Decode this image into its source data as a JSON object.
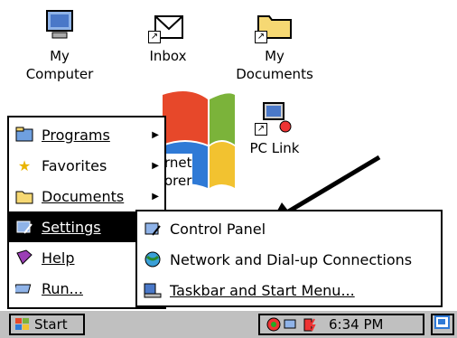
{
  "desktop": {
    "icons": [
      {
        "label": "My\nComputer"
      },
      {
        "label": "Inbox"
      },
      {
        "label": "My\nDocuments"
      },
      {
        "label": "PC Link"
      }
    ],
    "ie_partial_lines": [
      "rnet",
      "orer"
    ]
  },
  "start_menu": {
    "items": [
      {
        "label": "Programs",
        "submenu": true
      },
      {
        "label": "Favorites",
        "submenu": true
      },
      {
        "label": "Documents",
        "submenu": true
      },
      {
        "label": "Settings",
        "submenu": true,
        "selected": true
      },
      {
        "label": "Help",
        "submenu": false
      },
      {
        "label": "Run...",
        "submenu": false
      }
    ]
  },
  "settings_submenu": {
    "items": [
      {
        "label": "Control Panel"
      },
      {
        "label": "Network and Dial-up Connections"
      },
      {
        "label": "Taskbar and Start Menu..."
      }
    ]
  },
  "taskbar": {
    "start_label": "Start",
    "clock": "6:34 PM"
  },
  "colors": {
    "taskbar_bg": "#c0c0c0",
    "selection": "#000000"
  }
}
